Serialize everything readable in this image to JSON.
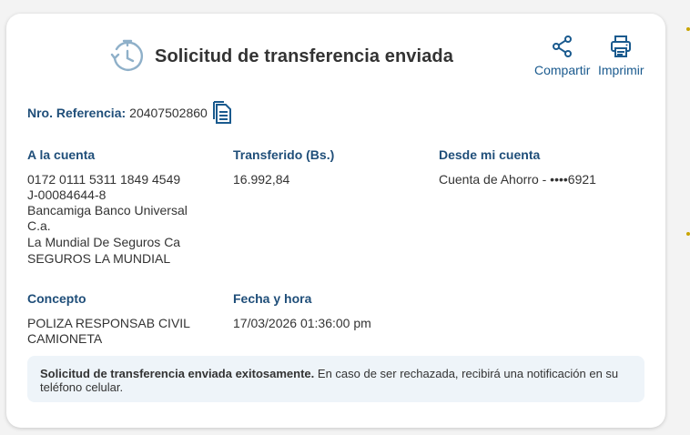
{
  "header": {
    "title": "Solicitud de transferencia enviada",
    "icon": "clock-history-icon"
  },
  "actions": {
    "share_label": "Compartir",
    "print_label": "Imprimir",
    "accent": "#1a5a8e"
  },
  "reference": {
    "label": "Nro. Referencia:",
    "value": "20407502860"
  },
  "to_account": {
    "label": "A la cuenta",
    "account_number": "0172 0111 5311 1849 4549",
    "id": "J-00084644-8",
    "bank": "Bancamiga Banco Universal C.a.",
    "holder": "La Mundial De Seguros Ca",
    "alias": "SEGUROS LA MUNDIAL"
  },
  "amount": {
    "label": "Transferido (Bs.)",
    "value": "16.992,84"
  },
  "from_account": {
    "label": "Desde mi cuenta",
    "value": "Cuenta de Ahorro - ••••6921"
  },
  "concept": {
    "label": "Concepto",
    "value": "POLIZA RESPONSAB CIVIL CAMIONETA"
  },
  "datetime": {
    "label": "Fecha y hora",
    "value": "17/03/2026 01:36:00 pm"
  },
  "notice": {
    "bold": "Solicitud de transferencia enviada exitosamente.",
    "text": " En caso de ser rechazada, recibirá una notificación en su teléfono celular."
  }
}
